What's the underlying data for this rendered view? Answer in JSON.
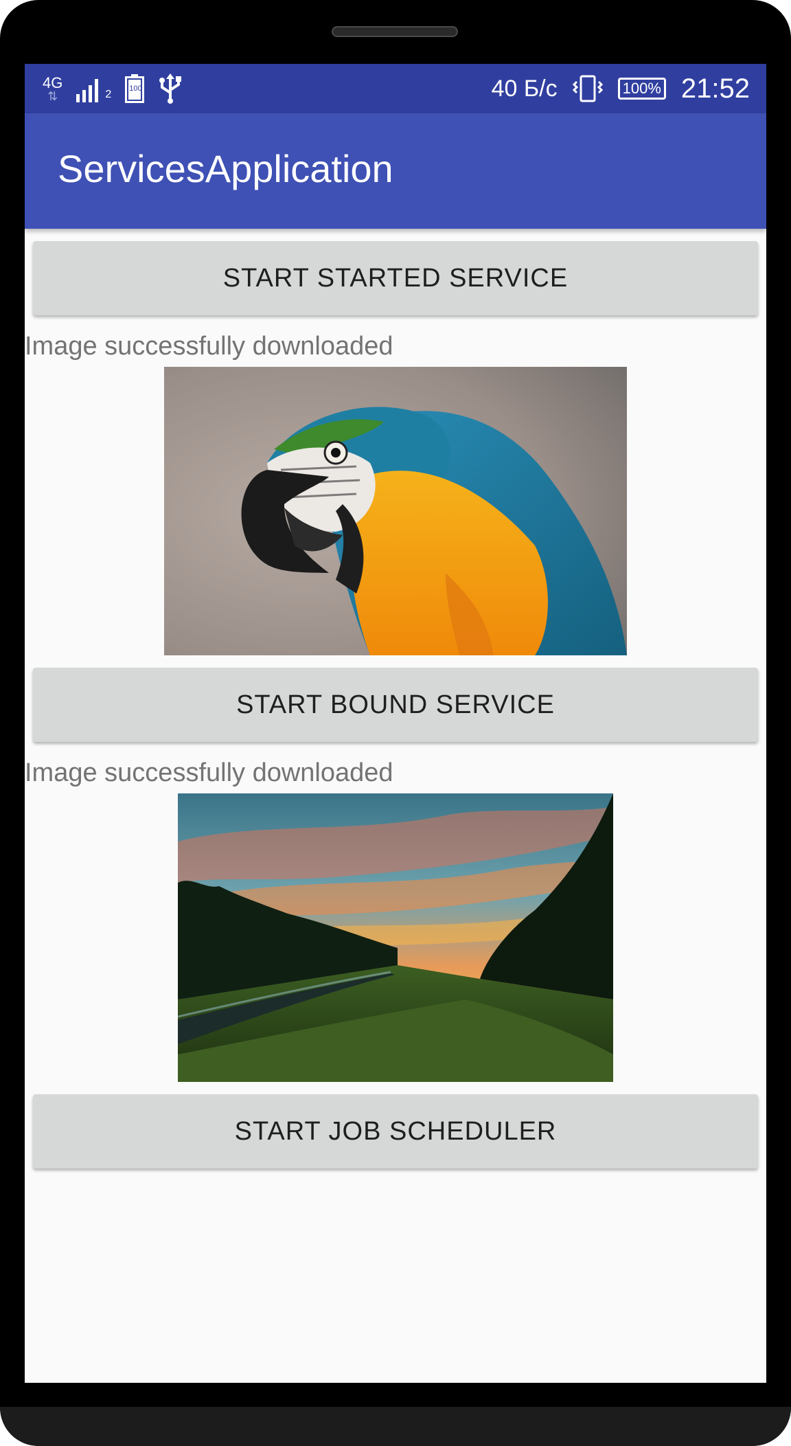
{
  "status_bar": {
    "network_type": "4G",
    "network_arrows": "⇅",
    "signal_sub": "2",
    "battery_small": "100",
    "data_rate": "40 Б/с",
    "battery_percent": "100%",
    "time": "21:52"
  },
  "app_bar": {
    "title": "ServicesApplication",
    "color": "#3f51b5",
    "status_color": "#303f9f"
  },
  "main": {
    "buttons": {
      "started_service": "START STARTED SERVICE",
      "bound_service": "START BOUND SERVICE",
      "job_scheduler": "START JOB SCHEDULER"
    },
    "started_status": "Image successfully downloaded",
    "bound_status": "Image successfully downloaded"
  },
  "icons": [
    "signal-icon",
    "battery-saver-icon",
    "usb-icon",
    "vibrate-icon",
    "battery-icon"
  ]
}
